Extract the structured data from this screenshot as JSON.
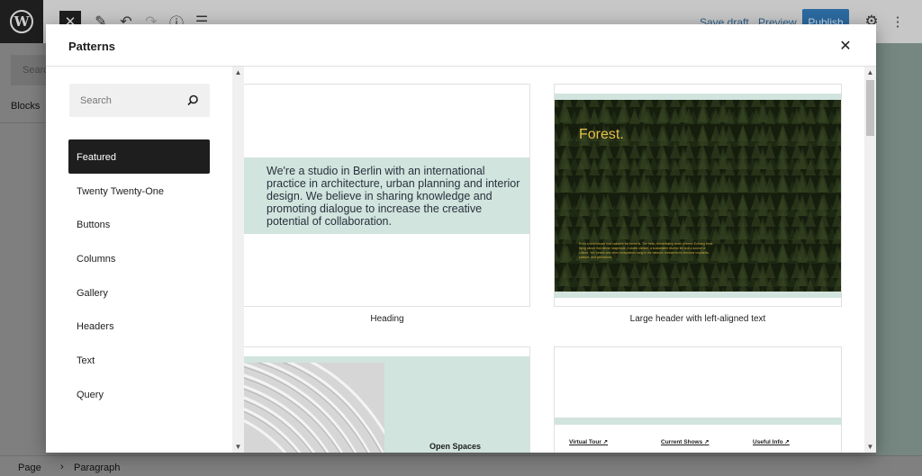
{
  "editor": {
    "logo": "W",
    "close_glyph": "✕",
    "toolbar_icons": [
      "✎",
      "↶",
      "↷",
      "ⓘ",
      "☰"
    ],
    "save_draft": "Save draft",
    "preview": "Preview",
    "publish": "Publish",
    "settings_glyph": "⚙",
    "more_glyph": "⋮",
    "left_search": "Search",
    "left_blocks": "Blocks",
    "breadcrumb": {
      "page": "Page",
      "separator": "›",
      "paragraph": "Paragraph"
    }
  },
  "modal": {
    "title": "Patterns",
    "close_glyph": "✕",
    "search": {
      "placeholder": "Search",
      "icon": "search-icon"
    },
    "categories": [
      {
        "label": "Featured",
        "active": true
      },
      {
        "label": "Twenty Twenty-One",
        "active": false
      },
      {
        "label": "Buttons",
        "active": false
      },
      {
        "label": "Columns",
        "active": false
      },
      {
        "label": "Gallery",
        "active": false
      },
      {
        "label": "Headers",
        "active": false
      },
      {
        "label": "Text",
        "active": false
      },
      {
        "label": "Query",
        "active": false
      }
    ],
    "patterns": {
      "heading": {
        "label": "Heading",
        "text": "We're a studio in Berlin with an international practice in architecture, urban planning and interior design. We believe in sharing knowledge and promoting dialogue to increase the creative potential of collaboration."
      },
      "large_header": {
        "label": "Large header with left-aligned text",
        "title": "Forest.",
        "body": "Even a child knows how valuable the forest is. The fresh, breathtaking smell of trees. Echoing birds flying above that dense magnitude. A stable climate, a sustainable diverse life and a source of culture. Yet, forests and other ecosystems hang in the balance, threatened to become croplands, pasture, and plantations."
      },
      "open_spaces": {
        "title": "Open Spaces"
      },
      "links": {
        "items": [
          "Virtual Tour ↗",
          "Current Shows ↗",
          "Useful Info ↗"
        ]
      }
    },
    "scroll_up": "▲",
    "scroll_down": "▼"
  },
  "colors": {
    "accent_green": "#d1e4dd",
    "dark": "#1e1e1e",
    "forest_gold": "#e6c04a"
  }
}
